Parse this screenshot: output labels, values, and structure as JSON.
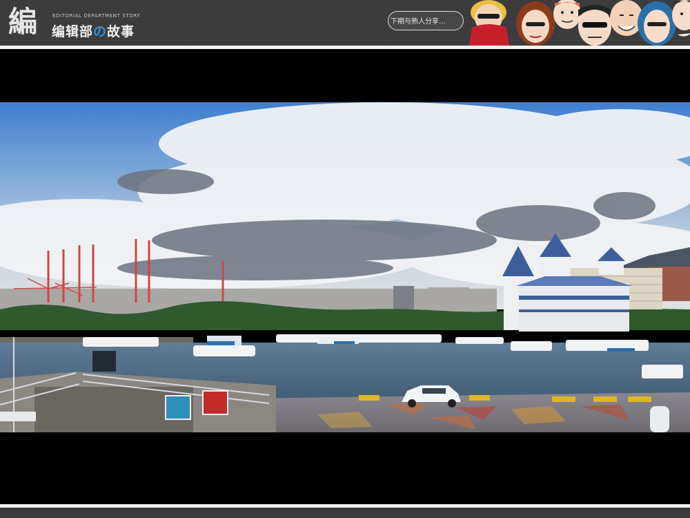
{
  "header": {
    "logo_glyph": "編",
    "logo_subtitle": "EDITORIAL DEPARTMENT STORY",
    "logo_title_a": "编辑部",
    "logo_title_no": "の",
    "logo_title_b": "故事",
    "speech_bubble": "下期与熟人分享…"
  },
  "photo": {
    "subject": "harbor-marina-panorama"
  },
  "colors": {
    "header_bg": "#3a3a3a",
    "rule": "#f2f2f2",
    "accent_blue": "#2f8fe0",
    "letterbox": "#000000"
  }
}
